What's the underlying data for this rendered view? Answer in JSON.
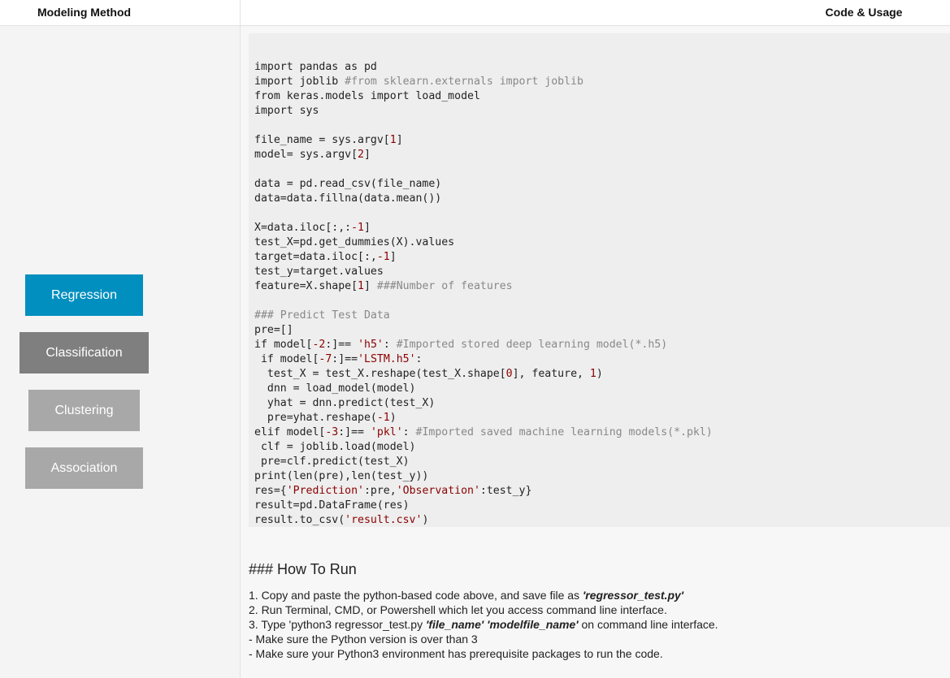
{
  "header": {
    "left_title": "Modeling Method",
    "right_title": "Code & Usage"
  },
  "sidebar": {
    "buttons": [
      {
        "label": "Regression",
        "color": "#008fbf",
        "state": "active"
      },
      {
        "label": "Classification",
        "color": "#7f7f7f",
        "state": "default"
      },
      {
        "label": "Clustering",
        "color": "#a8a8a8",
        "state": "default"
      },
      {
        "label": "Association",
        "color": "#a8a8a8",
        "state": "default"
      }
    ]
  },
  "code": {
    "lines": [
      "import pandas as pd",
      "import joblib #from sklearn.externals import joblib",
      "from keras.models import load_model",
      "import sys",
      "",
      "file_name = sys.argv[1]",
      "model= sys.argv[2]",
      "",
      "data = pd.read_csv(file_name)",
      "data=data.fillna(data.mean())",
      "",
      "X=data.iloc[:,:-1]",
      "test_X=pd.get_dummies(X).values",
      "target=data.iloc[:,-1]",
      "test_y=target.values",
      "feature=X.shape[1] ###Number of features",
      "",
      "### Predict Test Data",
      "pre=[]",
      "if model[-2:]== 'h5': #Imported stored deep learning model(*.h5)",
      " if model[-7:]=='LSTM.h5':",
      "  test_X = test_X.reshape(test_X.shape[0], feature, 1)",
      "  dnn = load_model(model)",
      "  yhat = dnn.predict(test_X)",
      "  pre=yhat.reshape(-1)",
      "elif model[-3:]== 'pkl': #Imported saved machine learning models(*.pkl)",
      " clf = joblib.load(model)",
      " pre=clf.predict(test_X)",
      "print(len(pre),len(test_y))",
      "res={'Prediction':pre,'Observation':test_y}",
      "result=pd.DataFrame(res)",
      "result.to_csv('result.csv')"
    ],
    "comment_color": "#888888",
    "literal_color": "#8b0000"
  },
  "how_to_run": {
    "title": "### How To Run",
    "step1_prefix": "1. Copy and paste the python-based code above, and save file as ",
    "step1_file": "'regressor_test.py'",
    "step2": "2. Run Terminal, CMD, or Powershell which let you access command line interface.",
    "step3_prefix": "3. Type 'python3 regressor_test.py ",
    "step3_args": "'file_name' 'modelfile_name'",
    "step3_suffix": " on command line interface.",
    "note1": "- Make sure the Python version is over than 3",
    "note2": "- Make sure your Python3 environment has prerequisite packages to run the code."
  }
}
